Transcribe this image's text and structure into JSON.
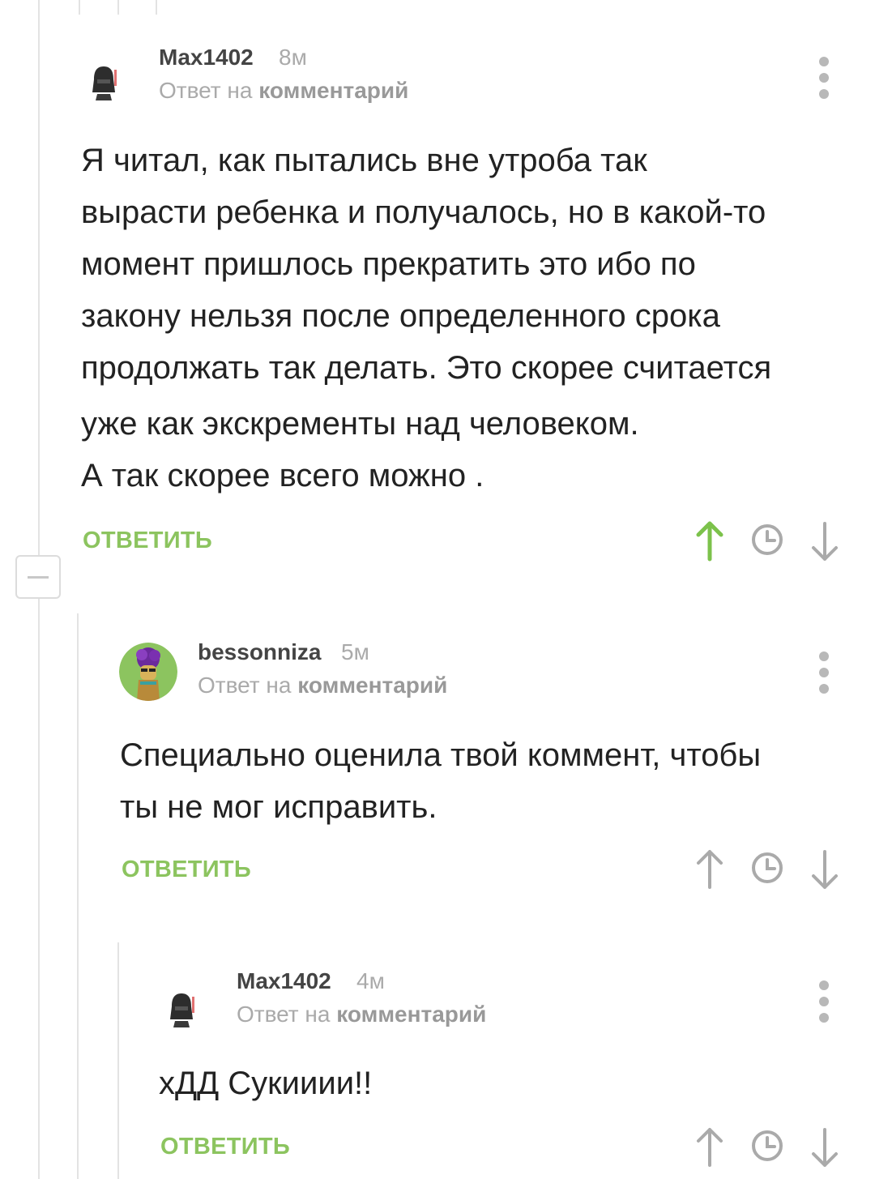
{
  "comments": [
    {
      "username": "Max1402",
      "time": "8м",
      "reply_prefix": "Ответ на",
      "reply_link": "комментарий",
      "lines": [
        "Я читал, как пытались вне утроба так",
        "вырасти ребенка и получалось, но в какой-то",
        "момент пришлось прекратить это ибо по",
        "закону нельзя после определенного срока",
        "продолжать так делать. Это скорее считается",
        "уже как экскременты над человеком.",
        "А так скорее всего можно ."
      ],
      "reply_label": "ОТВЕТИТЬ",
      "upvoted": true,
      "avatar_icon": "darth-vader-avatar"
    },
    {
      "username": "bessonniza",
      "time": "5м",
      "reply_prefix": "Ответ на",
      "reply_link": "комментарий",
      "lines": [
        "Специально оценила твой коммент, чтобы",
        "ты не мог исправить."
      ],
      "reply_label": "ОТВЕТИТЬ",
      "upvoted": false,
      "avatar_icon": "figure-purple-hair-avatar"
    },
    {
      "username": "Max1402",
      "time": "4м",
      "reply_prefix": "Ответ на",
      "reply_link": "комментарий",
      "lines": [
        "хДД Сукииии!!"
      ],
      "reply_label": "ОТВЕТИТЬ",
      "upvoted": false,
      "avatar_icon": "darth-vader-avatar"
    }
  ],
  "colors": {
    "accent_green": "#8cc45f",
    "icon_gray": "#aaaaaa",
    "meta_gray": "#aaaaaa",
    "text": "#222222"
  }
}
